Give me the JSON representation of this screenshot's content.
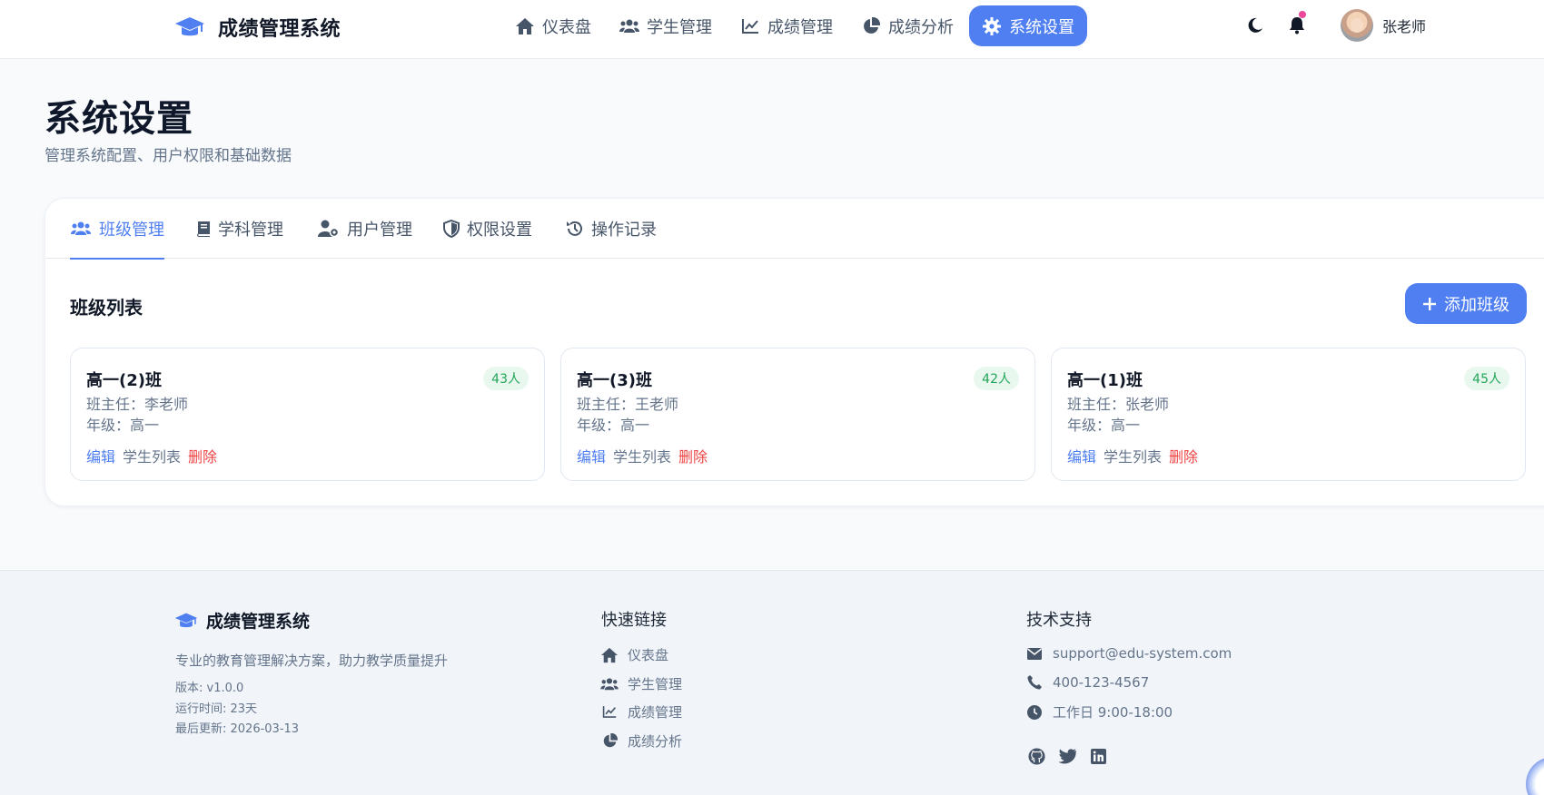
{
  "app": {
    "brand": "成绩管理系统"
  },
  "nav": [
    {
      "label": "仪表盘",
      "icon": "home-icon"
    },
    {
      "label": "学生管理",
      "icon": "users-icon"
    },
    {
      "label": "成绩管理",
      "icon": "line-chart-icon"
    },
    {
      "label": "成绩分析",
      "icon": "pie-chart-icon"
    },
    {
      "label": "系统设置",
      "icon": "gear-icon",
      "active": true
    }
  ],
  "header": {
    "username": "张老师",
    "theme_icon": "moon-icon",
    "notify_icon": "bell-icon"
  },
  "page": {
    "title": "系统设置",
    "subtitle": "管理系统配置、用户权限和基础数据"
  },
  "tabs": [
    {
      "label": "班级管理",
      "icon": "users-icon",
      "active": true
    },
    {
      "label": "学科管理",
      "icon": "book-icon"
    },
    {
      "label": "用户管理",
      "icon": "user-cog-icon"
    },
    {
      "label": "权限设置",
      "icon": "shield-icon"
    },
    {
      "label": "操作记录",
      "icon": "history-icon"
    }
  ],
  "section": {
    "title": "班级列表",
    "add_label": "添加班级"
  },
  "classes": [
    {
      "name": "高一(2)班",
      "count": "43人",
      "teacher": "班主任：李老师",
      "grade": "年级：高一"
    },
    {
      "name": "高一(3)班",
      "count": "42人",
      "teacher": "班主任：王老师",
      "grade": "年级：高一"
    },
    {
      "name": "高一(1)班",
      "count": "45人",
      "teacher": "班主任：张老师",
      "grade": "年级：高一"
    }
  ],
  "actions": {
    "edit": "编辑",
    "students": "学生列表",
    "delete": "删除"
  },
  "footer": {
    "brand": "成绩管理系统",
    "desc": "专业的教育管理解决方案，助力教学质量提升",
    "version": "版本: v1.0.0",
    "uptime": "运行时间: 23天",
    "updated": "最后更新: 2026-03-13",
    "quick_title": "快速链接",
    "quick_links": [
      "仪表盘",
      "学生管理",
      "成绩管理",
      "成绩分析"
    ],
    "support_title": "技术支持",
    "email": "support@edu-system.com",
    "phone": "400-123-4567",
    "hours": "工作日 9:00-18:00"
  },
  "colors": {
    "accent": "#4f7ff0",
    "danger": "#ef4444",
    "success": "#22a55a"
  }
}
